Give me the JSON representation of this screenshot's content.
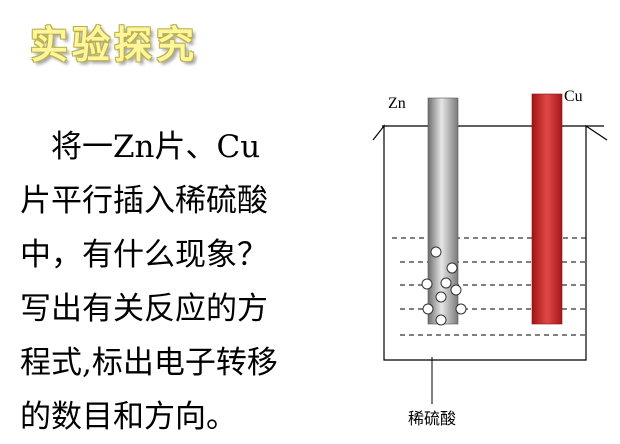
{
  "slide": {
    "title": "实验探究",
    "question": "　将一Zn片、Cu\n片平行插入稀硫酸\n中，有什么现象？\n写出有关反应的方\n程式,标出电子转移\n的数目和方向。"
  },
  "figure": {
    "zinc_label": "Zn",
    "copper_label": "Cu",
    "solution_label": "稀硫酸",
    "colors": {
      "zinc_electrode": "#a0a0a0",
      "copper_electrode": "#c8282a",
      "outline": "#000000"
    },
    "bubble_count": 9
  }
}
